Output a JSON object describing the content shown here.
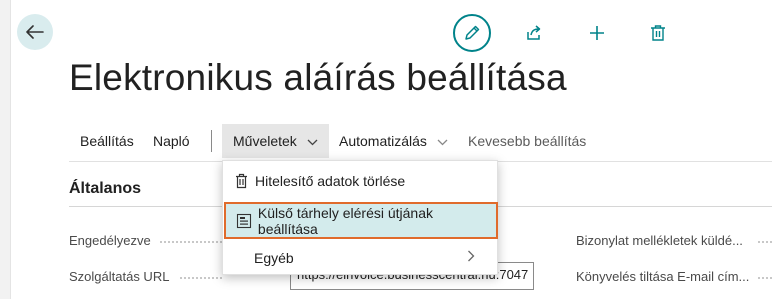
{
  "page": {
    "title": "Elektronikus aláírás beállítása"
  },
  "top_actions": [
    "edit-icon",
    "share-icon",
    "add-icon",
    "delete-icon"
  ],
  "action_bar": {
    "items": [
      {
        "label": "Beállítás"
      },
      {
        "label": "Napló"
      },
      {
        "label": "Műveletek"
      },
      {
        "label": "Automatizálás"
      },
      {
        "label": "Kevesebb beállítás"
      }
    ]
  },
  "dropdown": {
    "items": [
      {
        "label": "Hitelesítő adatok törlése",
        "icon": "trash-icon"
      },
      {
        "label": "Külső tárhely elérési útjának beállítása",
        "icon": "storage-setup-icon"
      },
      {
        "label": "Egyéb",
        "icon": "chevron-right-icon"
      }
    ]
  },
  "section": {
    "title": "Általanos",
    "fields": [
      {
        "label": "Engedélyezve"
      },
      {
        "label": "Szolgáltatás URL",
        "value": "https://einvoice.businesscentral.hu:7047"
      },
      {
        "label": "Bizonylat mellékletek küldé..."
      },
      {
        "label": "Könyvelés tiltása E-mail cím..."
      }
    ]
  },
  "colors": {
    "accent": "#00838a",
    "highlight_border": "#e06b2c",
    "highlight_bg": "#d3ebec"
  }
}
